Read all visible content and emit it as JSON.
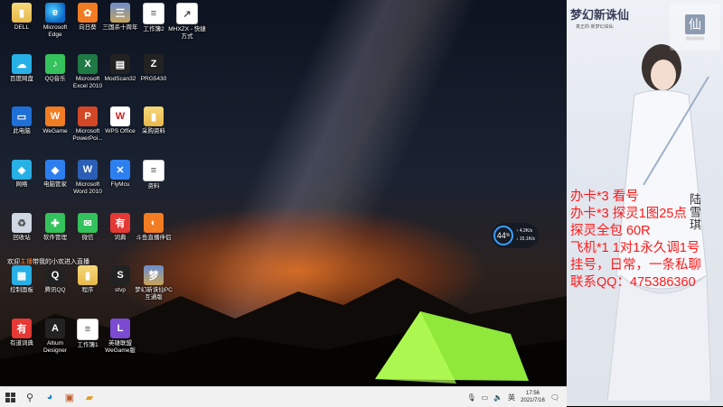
{
  "desktop": {
    "icons": [
      {
        "label": "DELL",
        "glyph": "▮",
        "style": "g-folder"
      },
      {
        "label": "Microsoft Edge",
        "glyph": "e",
        "style": "g-edge"
      },
      {
        "label": "向日葵",
        "glyph": "✿",
        "style": "g-orange"
      },
      {
        "label": "三国杀十周年",
        "glyph": "三",
        "style": "g-game"
      },
      {
        "label": "工作簿2",
        "glyph": "≡",
        "style": "g-doc"
      },
      {
        "label": "MHXZX - 快捷方式",
        "glyph": "↗",
        "style": "g-doc"
      },
      {
        "label": "百度网盘",
        "glyph": "☁",
        "style": "g-cyan"
      },
      {
        "label": "QQ音乐",
        "glyph": "♪",
        "style": "g-green"
      },
      {
        "label": "Microsoft Excel 2010",
        "glyph": "X",
        "style": "g-excel"
      },
      {
        "label": "ModScan32",
        "glyph": "▤",
        "style": "g-dark"
      },
      {
        "label": "PRG5430",
        "glyph": "Z",
        "style": "g-dark"
      },
      {
        "label": "此电脑",
        "glyph": "▭",
        "style": "g-pc"
      },
      {
        "label": "WeGame",
        "glyph": "W",
        "style": "g-orange"
      },
      {
        "label": "Microsoft PowerPoi...",
        "glyph": "P",
        "style": "g-ppt"
      },
      {
        "label": "WPS Office",
        "glyph": "W",
        "style": "g-wps"
      },
      {
        "label": "采购资料",
        "glyph": "▮",
        "style": "g-folder"
      },
      {
        "label": "网络",
        "glyph": "◈",
        "style": "g-cyan"
      },
      {
        "label": "电脑管家",
        "glyph": "◆",
        "style": "g-blue"
      },
      {
        "label": "Microsoft Word 2010",
        "glyph": "W",
        "style": "g-word"
      },
      {
        "label": "FlyMcu",
        "glyph": "✕",
        "style": "g-blue"
      },
      {
        "label": "资料",
        "glyph": "≡",
        "style": "g-doc"
      },
      {
        "label": "回收站",
        "glyph": "♻",
        "style": "g-trash"
      },
      {
        "label": "软件管理",
        "glyph": "✚",
        "style": "g-green"
      },
      {
        "label": "微信",
        "glyph": "✉",
        "style": "g-green"
      },
      {
        "label": "词典",
        "glyph": "有",
        "style": "g-red"
      },
      {
        "label": "斗鱼直播伴侣",
        "glyph": "◐",
        "style": "g-orange"
      },
      {
        "label": "控制面板",
        "glyph": "▦",
        "style": "g-cyan"
      },
      {
        "label": "腾讯QQ",
        "glyph": "Q",
        "style": "g-dark"
      },
      {
        "label": "程序",
        "glyph": "▮",
        "style": "g-folder"
      },
      {
        "label": "stvp",
        "glyph": "S",
        "style": "g-dark"
      },
      {
        "label": "梦幻新诛仙PC互通版",
        "glyph": "梦",
        "style": "g-game"
      },
      {
        "label": "有道词典",
        "glyph": "有",
        "style": "g-red"
      },
      {
        "label": "Altium Designer",
        "glyph": "A",
        "style": "g-dark"
      },
      {
        "label": "工作簿1",
        "glyph": "≡",
        "style": "g-doc"
      },
      {
        "label": "英雄联盟WeGame版",
        "glyph": "L",
        "style": "g-purple"
      }
    ],
    "notice": {
      "prefix": "欢迎",
      "highlight": "主播",
      "suffix": "带我的小欢进入直播"
    },
    "speed_widget": {
      "percent": "44",
      "unit": "%",
      "up": "4.2K/s",
      "down": "15.1K/s"
    }
  },
  "taskbar": {
    "start_icon": "windows-icon",
    "items": [
      "search-icon",
      "edge-icon",
      "app-icon",
      "folder-icon"
    ],
    "tray": {
      "time": "17:56",
      "date": "2021/7/16"
    }
  },
  "panel": {
    "game_title": "梦幻新诛仙",
    "game_subtitle": "真正的·新梦幻诛仙",
    "logo_text": "ZHUXIAN",
    "vertical_title": "陆雪琪",
    "promo_lines": [
      "办卡*3 看号",
      "办卡*3 探灵1图25点",
      "探灵全包 60R",
      "飞机*1 1对1永久调1号",
      "挂号，日常，一条私聊",
      "联系QQ：475386360"
    ]
  }
}
